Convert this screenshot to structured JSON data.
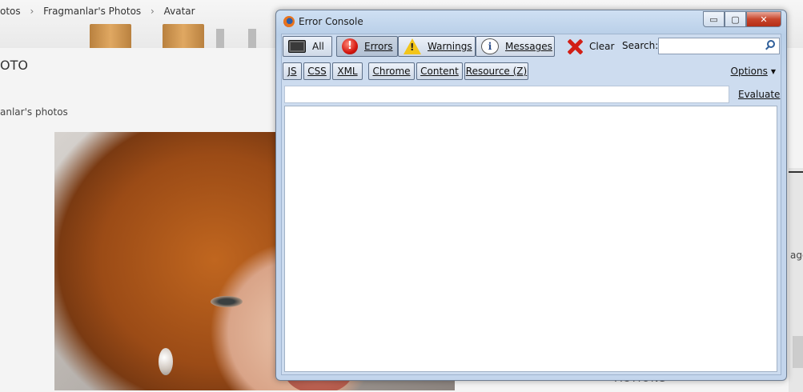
{
  "background_page": {
    "breadcrumb": [
      "otos",
      "Fragmanlar's Photos",
      "Avatar"
    ],
    "breadcrumb_separator": "›",
    "title": "OTO",
    "subtitle": "anlar's photos",
    "right_text": "age",
    "actions_heading": "ACTIONS"
  },
  "window": {
    "title": "Error Console",
    "controls": {
      "minimize": "▭",
      "maximize": "▢",
      "close": "✕"
    }
  },
  "toolbar": {
    "all": "All",
    "errors": "Errors",
    "warnings": "Warnings",
    "messages": "Messages",
    "clear": "Clear",
    "search_label": "Search:",
    "search_value": ""
  },
  "filters": {
    "js": "JS",
    "css": "CSS",
    "xml": "XML",
    "chrome": "Chrome",
    "content": "Content",
    "resource": "Resource (Z)",
    "options": "Options"
  },
  "evaluate": {
    "input_value": "",
    "button": "Evaluate"
  },
  "icons": {
    "errors": "!",
    "warnings": "!",
    "messages": "i"
  }
}
